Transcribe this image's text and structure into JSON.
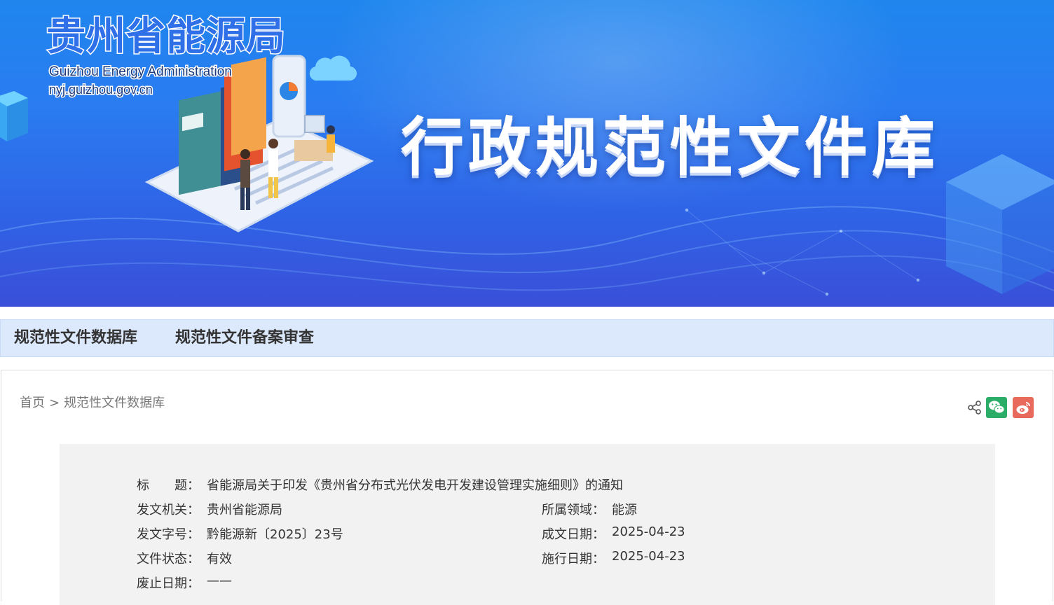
{
  "banner": {
    "brand_cn": "贵州省能源局",
    "brand_en": "Guizhou Energy Administration",
    "brand_url": "nyj.guizhou.gov.cn",
    "title": "行政规范性文件库"
  },
  "nav": {
    "items": [
      "规范性文件数据库",
      "规范性文件备案审查"
    ]
  },
  "breadcrumb": {
    "home": "首页",
    "separator": ">",
    "current": "规范性文件数据库"
  },
  "share": {
    "icons": [
      "share-icon",
      "wechat-icon",
      "weibo-icon"
    ],
    "colors": {
      "wechat": "#2aae67",
      "weibo": "#e86a5c"
    }
  },
  "info": {
    "title_label": "标　　题：",
    "title_value": "省能源局关于印发《贵州省分布式光伏发电开发建设管理实施细则》的通知",
    "issuer_label": "发文机关：",
    "issuer_value": "贵州省能源局",
    "domain_label": "所属领域：",
    "domain_value": "能源",
    "docno_label": "发文字号：",
    "docno_value": "黔能源新〔2025〕23号",
    "created_label": "成文日期：",
    "created_value": "2025-04-23",
    "status_label": "文件状态：",
    "status_value": "有效",
    "effective_label": "施行日期：",
    "effective_value": "2025-04-23",
    "abolished_label": "废止日期：",
    "abolished_value": "——"
  }
}
